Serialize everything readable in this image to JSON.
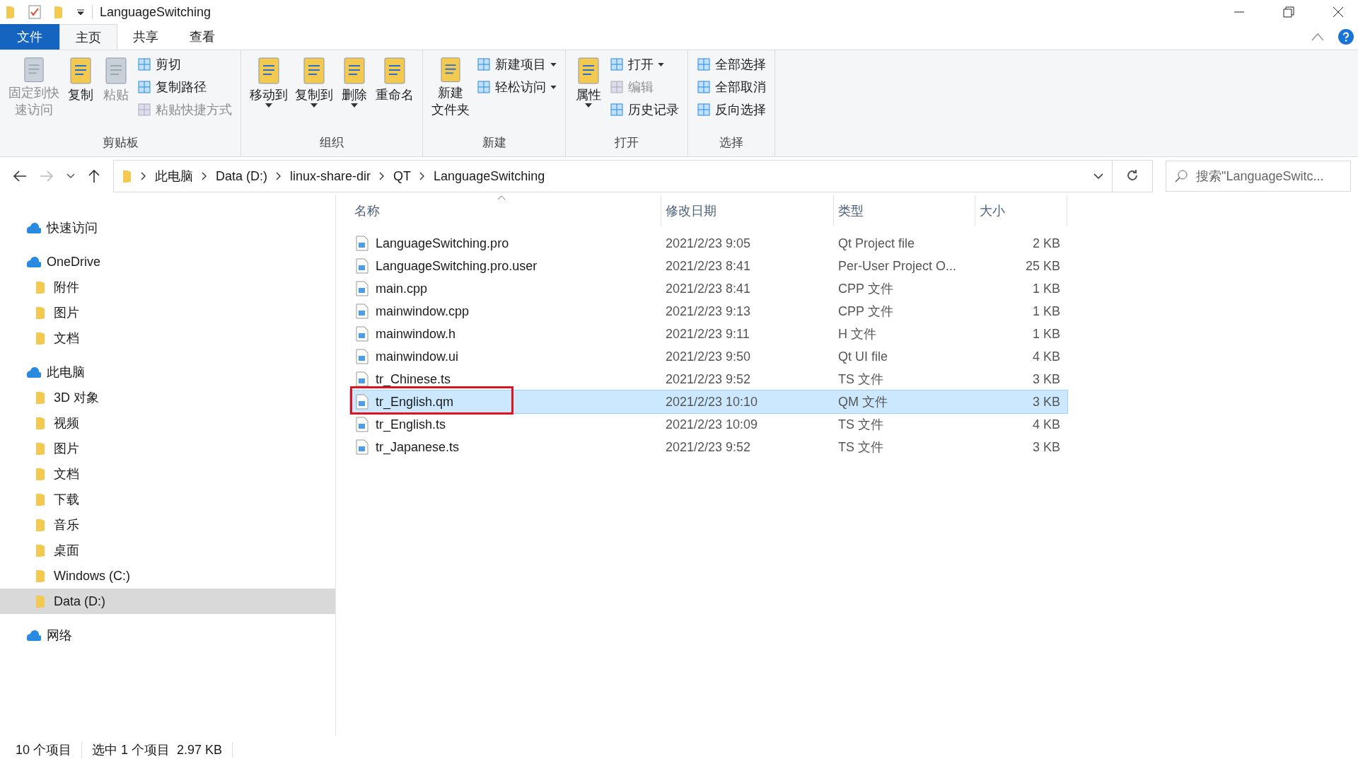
{
  "window": {
    "title": "LanguageSwitching"
  },
  "tabs": [
    {
      "label": "文件",
      "kind": "file",
      "selected": false
    },
    {
      "label": "主页",
      "kind": "tab",
      "selected": true
    },
    {
      "label": "共享",
      "kind": "tab",
      "selected": false
    },
    {
      "label": "查看",
      "kind": "tab",
      "selected": false
    }
  ],
  "ribbon": {
    "groups": [
      {
        "label": "剪贴板",
        "items": [
          {
            "kind": "large",
            "lines": [
              "固定到快",
              "速访问"
            ],
            "disabled": true,
            "dropdown": false
          },
          {
            "kind": "large",
            "lines": [
              "复制"
            ],
            "disabled": false,
            "dropdown": false
          },
          {
            "kind": "large",
            "lines": [
              "粘贴"
            ],
            "disabled": true,
            "dropdown": false
          },
          {
            "kind": "small",
            "lines": [
              "剪切"
            ],
            "disabled": false,
            "dropdown": false
          },
          {
            "kind": "small",
            "lines": [
              "复制路径"
            ],
            "disabled": false,
            "dropdown": false
          },
          {
            "kind": "small",
            "lines": [
              "粘贴快捷方式"
            ],
            "disabled": true,
            "dropdown": false
          }
        ]
      },
      {
        "label": "组织",
        "items": [
          {
            "kind": "large",
            "lines": [
              "移动到"
            ],
            "disabled": false,
            "dropdown": true
          },
          {
            "kind": "large",
            "lines": [
              "复制到"
            ],
            "disabled": false,
            "dropdown": true
          },
          {
            "kind": "large",
            "lines": [
              "删除"
            ],
            "disabled": false,
            "dropdown": true
          },
          {
            "kind": "large",
            "lines": [
              "重命名"
            ],
            "disabled": false,
            "dropdown": false
          }
        ]
      },
      {
        "label": "新建",
        "items": [
          {
            "kind": "large",
            "lines": [
              "新建",
              "文件夹"
            ],
            "disabled": false,
            "dropdown": false
          },
          {
            "kind": "small",
            "lines": [
              "新建项目"
            ],
            "disabled": false,
            "dropdown": true
          },
          {
            "kind": "small",
            "lines": [
              "轻松访问"
            ],
            "disabled": false,
            "dropdown": true
          }
        ]
      },
      {
        "label": "打开",
        "items": [
          {
            "kind": "large",
            "lines": [
              "属性"
            ],
            "disabled": false,
            "dropdown": true
          },
          {
            "kind": "small",
            "lines": [
              "打开"
            ],
            "disabled": false,
            "dropdown": true
          },
          {
            "kind": "small",
            "lines": [
              "编辑"
            ],
            "disabled": true,
            "dropdown": false
          },
          {
            "kind": "small",
            "lines": [
              "历史记录"
            ],
            "disabled": false,
            "dropdown": false
          }
        ]
      },
      {
        "label": "选择",
        "items": [
          {
            "kind": "small",
            "lines": [
              "全部选择"
            ],
            "disabled": false,
            "dropdown": false
          },
          {
            "kind": "small",
            "lines": [
              "全部取消"
            ],
            "disabled": false,
            "dropdown": false
          },
          {
            "kind": "small",
            "lines": [
              "反向选择"
            ],
            "disabled": false,
            "dropdown": false
          }
        ]
      }
    ]
  },
  "address": {
    "crumbs": [
      "此电脑",
      "Data (D:)",
      "linux-share-dir",
      "QT",
      "LanguageSwitching"
    ]
  },
  "search": {
    "placeholder": "搜索\"LanguageSwitc..."
  },
  "sidebar": {
    "items": [
      {
        "label": "快速访问",
        "selected": false
      },
      {
        "label": "OneDrive",
        "selected": false,
        "children": [
          {
            "label": "附件",
            "selected": false
          },
          {
            "label": "图片",
            "selected": false
          },
          {
            "label": "文档",
            "selected": false
          }
        ]
      },
      {
        "label": "此电脑",
        "selected": false,
        "children": [
          {
            "label": "3D 对象",
            "selected": false
          },
          {
            "label": "视频",
            "selected": false
          },
          {
            "label": "图片",
            "selected": false
          },
          {
            "label": "文档",
            "selected": false
          },
          {
            "label": "下载",
            "selected": false
          },
          {
            "label": "音乐",
            "selected": false
          },
          {
            "label": "桌面",
            "selected": false
          },
          {
            "label": "Windows (C:)",
            "selected": false
          },
          {
            "label": "Data (D:)",
            "selected": true
          }
        ]
      },
      {
        "label": "网络",
        "selected": false
      }
    ]
  },
  "table": {
    "columns": [
      "名称",
      "修改日期",
      "类型",
      "大小"
    ],
    "rows": [
      {
        "name": "LanguageSwitching.pro",
        "date": "2021/2/23 9:05",
        "type": "Qt Project file",
        "size": "2 KB",
        "selected": false,
        "annotated": false
      },
      {
        "name": "LanguageSwitching.pro.user",
        "date": "2021/2/23 8:41",
        "type": "Per-User Project O...",
        "size": "25 KB",
        "selected": false,
        "annotated": false
      },
      {
        "name": "main.cpp",
        "date": "2021/2/23 8:41",
        "type": "CPP 文件",
        "size": "1 KB",
        "selected": false,
        "annotated": false
      },
      {
        "name": "mainwindow.cpp",
        "date": "2021/2/23 9:13",
        "type": "CPP 文件",
        "size": "1 KB",
        "selected": false,
        "annotated": false
      },
      {
        "name": "mainwindow.h",
        "date": "2021/2/23 9:11",
        "type": "H 文件",
        "size": "1 KB",
        "selected": false,
        "annotated": false
      },
      {
        "name": "mainwindow.ui",
        "date": "2021/2/23 9:50",
        "type": "Qt UI file",
        "size": "4 KB",
        "selected": false,
        "annotated": false
      },
      {
        "name": "tr_Chinese.ts",
        "date": "2021/2/23 9:52",
        "type": "TS 文件",
        "size": "3 KB",
        "selected": false,
        "annotated": false
      },
      {
        "name": "tr_English.qm",
        "date": "2021/2/23 10:10",
        "type": "QM 文件",
        "size": "3 KB",
        "selected": true,
        "annotated": true
      },
      {
        "name": "tr_English.ts",
        "date": "2021/2/23 10:09",
        "type": "TS 文件",
        "size": "4 KB",
        "selected": false,
        "annotated": false
      },
      {
        "name": "tr_Japanese.ts",
        "date": "2021/2/23 9:52",
        "type": "TS 文件",
        "size": "3 KB",
        "selected": false,
        "annotated": false
      }
    ]
  },
  "status_bar": {
    "count": "10 个项目",
    "selection": "选中 1 个项目  2.97 KB"
  }
}
